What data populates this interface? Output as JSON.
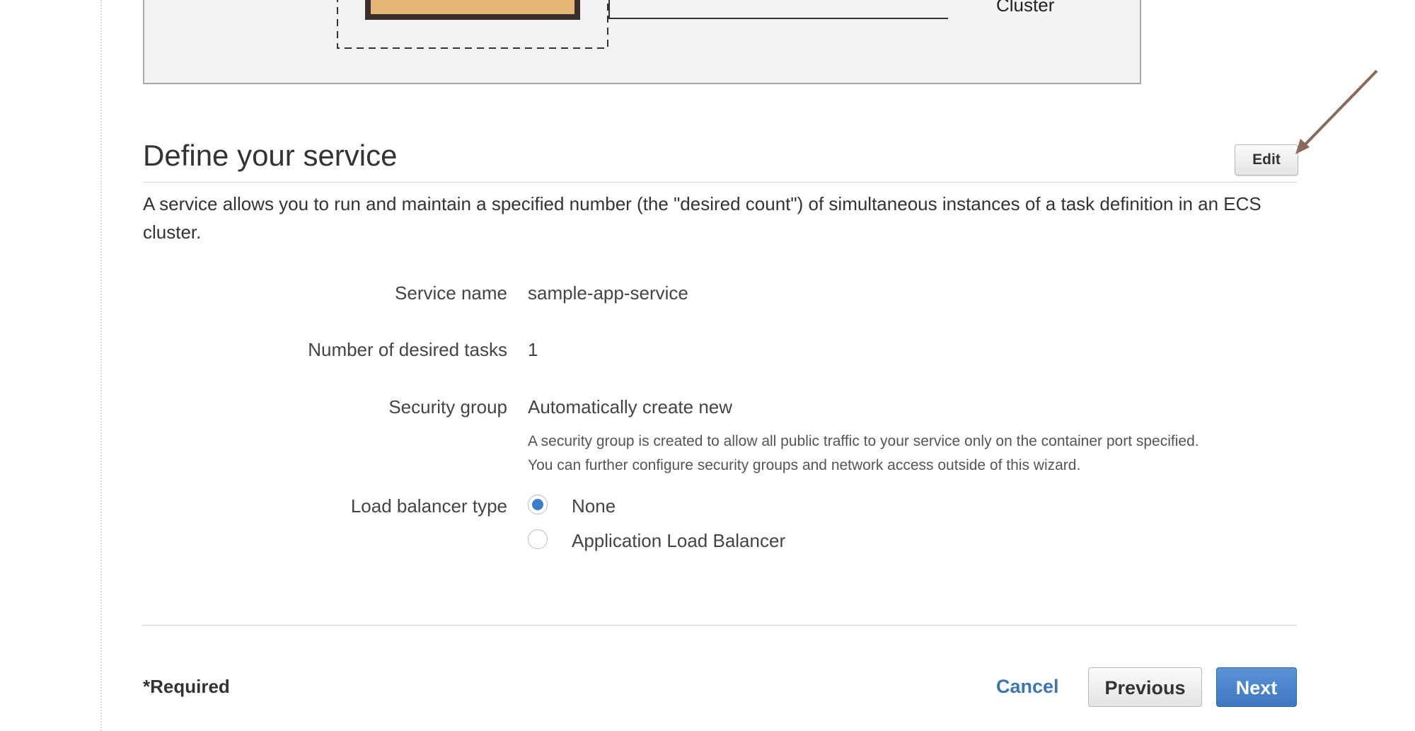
{
  "diagram": {
    "cluster_label": "Cluster"
  },
  "section": {
    "title": "Define your service",
    "edit_label": "Edit",
    "description": "A service allows you to run and maintain a specified number (the \"desired count\") of simultaneous instances of a task definition in an ECS cluster."
  },
  "fields": {
    "service_name": {
      "label": "Service name",
      "value": "sample-app-service"
    },
    "desired_tasks": {
      "label": "Number of desired tasks",
      "value": "1"
    },
    "security_group": {
      "label": "Security group",
      "value": "Automatically create new",
      "hint_line1": "A security group is created to allow all public traffic to your service only on the container port specified.",
      "hint_line2": "You can further configure security groups and network access outside of this wizard."
    },
    "load_balancer": {
      "label": "Load balancer type",
      "options": [
        "None",
        "Application Load Balancer"
      ],
      "selected": "None"
    }
  },
  "footer": {
    "required_label": "*Required",
    "cancel_label": "Cancel",
    "previous_label": "Previous",
    "next_label": "Next"
  },
  "colors": {
    "accent": "#3d7cc9",
    "annotation_arrow": "#8b6a55",
    "box_fill": "#e4b575"
  }
}
